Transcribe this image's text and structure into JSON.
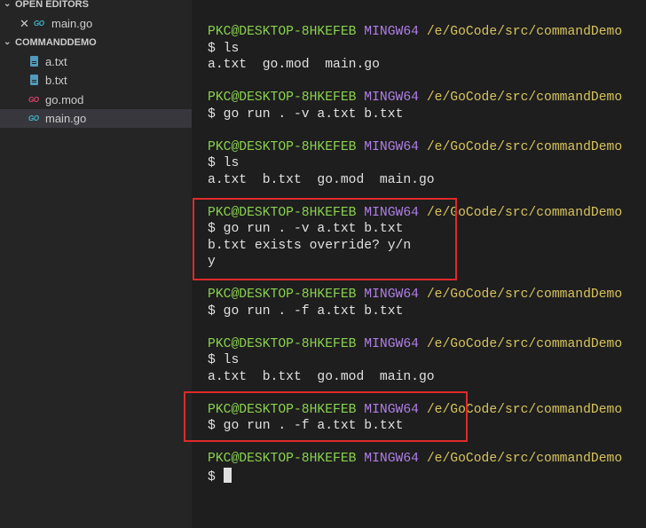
{
  "sidebar": {
    "open_editors_label": "OPEN EDITORS",
    "open_editors": [
      {
        "name": "main.go",
        "icon": "go-icon"
      }
    ],
    "project_label": "COMMANDDEMO",
    "files": [
      {
        "name": "a.txt",
        "icon": "text-file-icon"
      },
      {
        "name": "b.txt",
        "icon": "text-file-icon"
      },
      {
        "name": "go.mod",
        "icon": "go-mod-icon"
      },
      {
        "name": "main.go",
        "icon": "go-icon",
        "selected": true
      }
    ],
    "go_icon_text": "GO"
  },
  "terminal": {
    "user": "PKC@DESKTOP-8HKEFEB",
    "system": "MINGW64",
    "path": "/e/GoCode/src/commandDemo",
    "prompt_symbol": "$",
    "commands": [
      {
        "cmd": "ls",
        "output": [
          "a.txt  go.mod  main.go"
        ]
      },
      {
        "cmd": "go run . -v a.txt b.txt",
        "output": []
      },
      {
        "cmd": "ls",
        "output": [
          "a.txt  b.txt  go.mod  main.go"
        ]
      },
      {
        "cmd": "go run . -v a.txt b.txt",
        "output": [
          "b.txt exists override? y/n",
          "y"
        ]
      },
      {
        "cmd": "go run . -f a.txt b.txt",
        "output": []
      },
      {
        "cmd": "ls",
        "output": [
          "a.txt  b.txt  go.mod  main.go"
        ]
      },
      {
        "cmd": "go run . -f a.txt b.txt",
        "output": []
      }
    ]
  },
  "colors": {
    "highlight_box": "#e02a2a",
    "user": "#89d14f",
    "system": "#b07ee8",
    "path": "#d7c35e"
  }
}
